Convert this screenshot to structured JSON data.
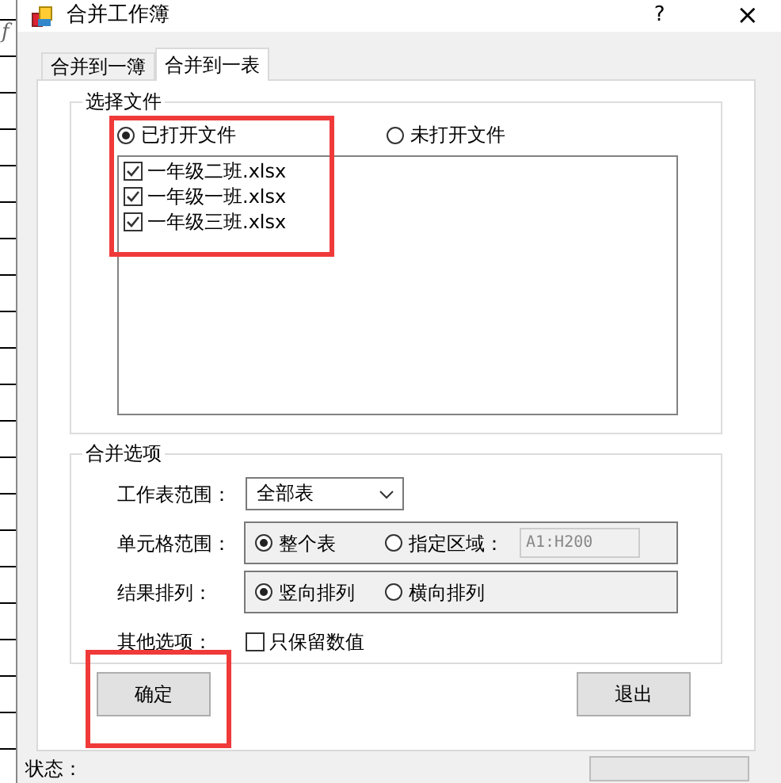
{
  "window": {
    "title": "合并工作簿",
    "help": "?",
    "close": "×"
  },
  "background": {
    "formula_label": "f"
  },
  "tabs": [
    {
      "label": "合并到一簿",
      "selected": false
    },
    {
      "label": "合并到一表",
      "selected": true
    }
  ],
  "file_group": {
    "title": "选择文件",
    "highlighted": true,
    "sources": [
      {
        "label": "已打开文件",
        "selected": true
      },
      {
        "label": "未打开文件",
        "selected": false
      }
    ],
    "files": [
      {
        "name": "一年级二班.xlsx",
        "checked": true
      },
      {
        "name": "一年级一班.xlsx",
        "checked": true
      },
      {
        "name": "一年级三班.xlsx",
        "checked": true
      }
    ]
  },
  "options_group": {
    "title": "合并选项",
    "rows": [
      {
        "kind": "dropdown",
        "label": "工作表范围：",
        "value": "全部表"
      },
      {
        "kind": "radios",
        "label": "单元格范围：",
        "options": [
          {
            "label": "整个表",
            "selected": true
          },
          {
            "label": "指定区域：",
            "selected": false
          }
        ],
        "field": {
          "value": "A1:H200",
          "disabled": true
        }
      },
      {
        "kind": "radios",
        "label": "结果排列：",
        "options": [
          {
            "label": "竖向排列",
            "selected": true
          },
          {
            "label": "横向排列",
            "selected": false
          }
        ]
      },
      {
        "kind": "checkbox",
        "label": "其他选项：",
        "text": "只保留数值",
        "checked": false
      }
    ]
  },
  "buttons": [
    {
      "label": "确定",
      "highlighted": true
    },
    {
      "label": "退出",
      "highlighted": false
    }
  ],
  "status_bar": {
    "label": "状态："
  }
}
